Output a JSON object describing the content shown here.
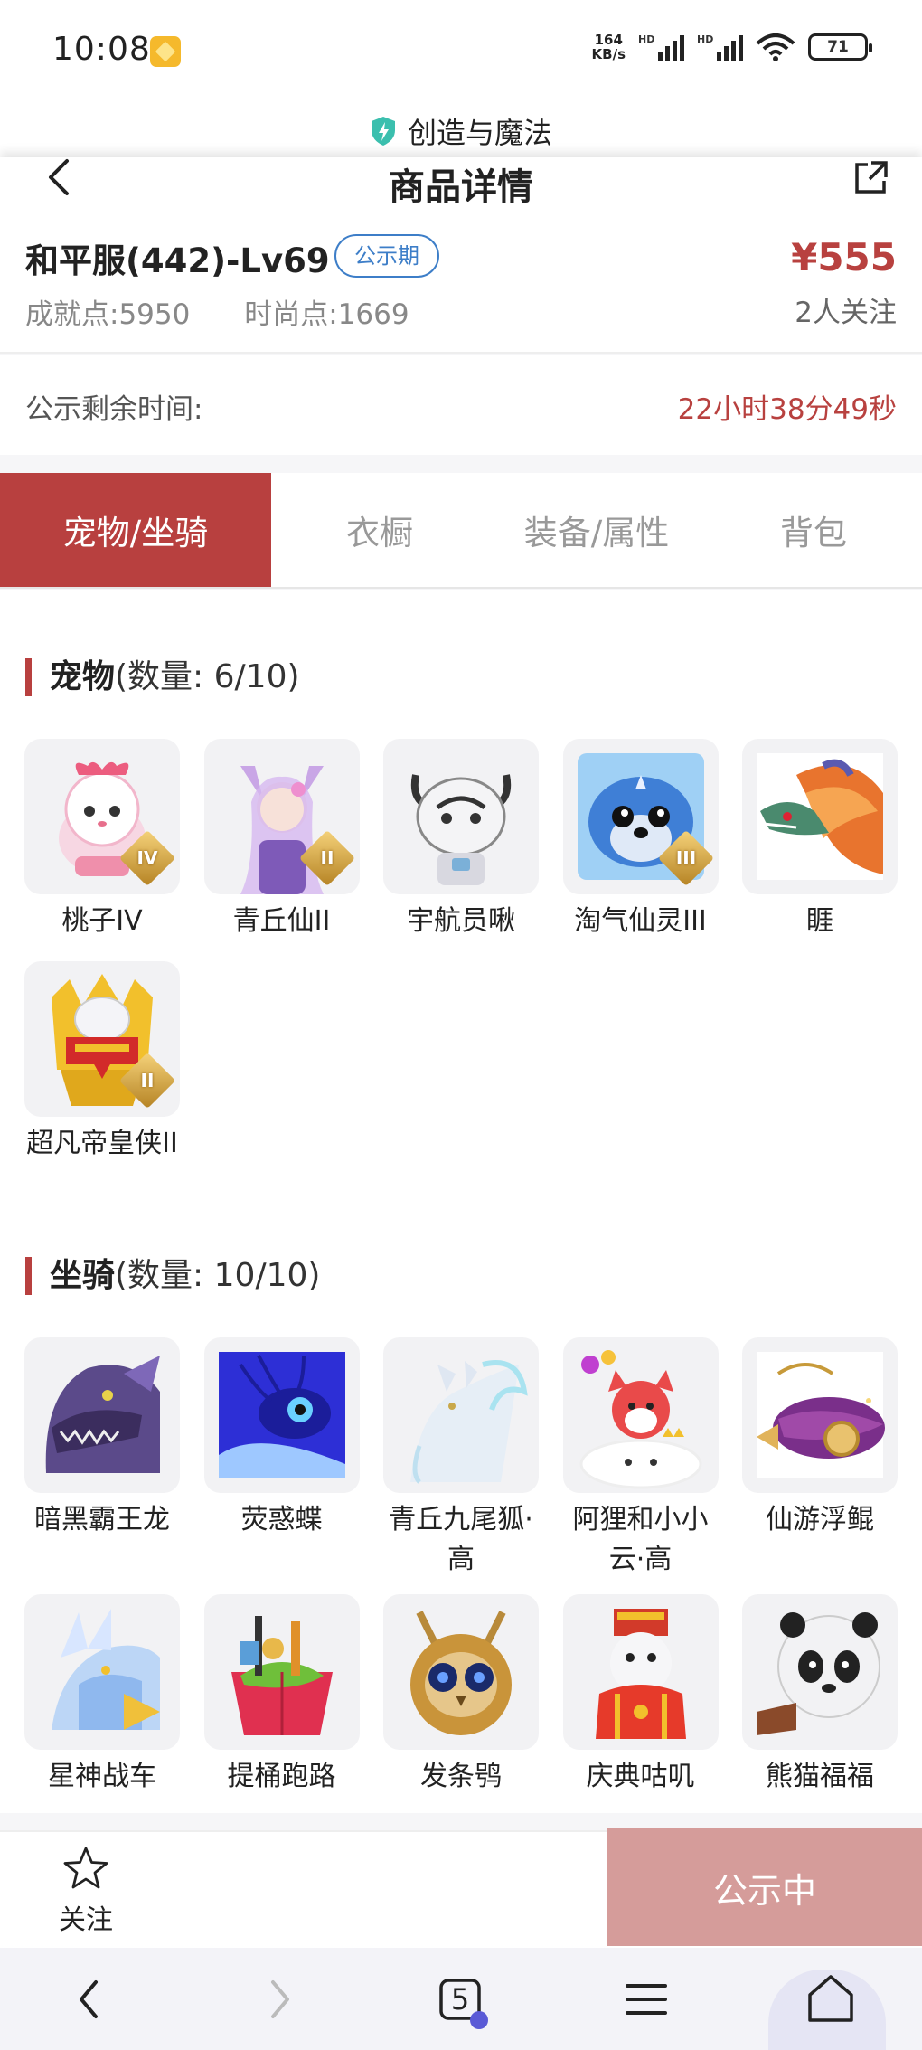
{
  "status_bar": {
    "time": "10:08",
    "net_speed_value": "164",
    "net_speed_unit": "KB/s",
    "signal1_label": "HD",
    "signal2_label": "HD",
    "battery": "71"
  },
  "site": {
    "name": "创造与魔法"
  },
  "header": {
    "title": "商品详情"
  },
  "product": {
    "title": "和平服(442)-Lv69",
    "badge": "公示期",
    "price": "¥555",
    "achievement": "成就点:5950",
    "fashion": "时尚点:1669",
    "followers": "2人关注"
  },
  "remaining": {
    "label": "公示剩余时间:",
    "value": "22小时38分49秒"
  },
  "tabs": [
    {
      "label": "宠物/坐骑",
      "active": true
    },
    {
      "label": "衣橱",
      "active": false
    },
    {
      "label": "装备/属性",
      "active": false
    },
    {
      "label": "背包",
      "active": false
    }
  ],
  "pets": {
    "title": "宠物",
    "count": "(数量: 6/10)",
    "items": [
      {
        "name": "桃子IV",
        "rank": "IV"
      },
      {
        "name": "青丘仙II",
        "rank": "II"
      },
      {
        "name": "宇航员啾",
        "rank": ""
      },
      {
        "name": "淘气仙灵III",
        "rank": "III"
      },
      {
        "name": "睚",
        "rank": ""
      },
      {
        "name": "超凡帝皇侠II",
        "rank": "II"
      }
    ]
  },
  "mounts": {
    "title": "坐骑",
    "count": "(数量: 10/10)",
    "items": [
      {
        "name": "暗黑霸王龙"
      },
      {
        "name": "荧惑蝶"
      },
      {
        "name": "青丘九尾狐·高"
      },
      {
        "name": "阿狸和小小云·高"
      },
      {
        "name": "仙游浮鲲"
      },
      {
        "name": "星神战车"
      },
      {
        "name": "提桶跑路"
      },
      {
        "name": "发条鸮"
      },
      {
        "name": "庆典咕叽"
      },
      {
        "name": "熊猫福福"
      }
    ]
  },
  "action_bar": {
    "follow_label": "关注",
    "status_label": "公示中"
  },
  "browser": {
    "tab_count": "5"
  },
  "colors": {
    "accent": "#b8403f",
    "badge": "#3d7ec8",
    "disabled_button": "#d59c9a"
  }
}
